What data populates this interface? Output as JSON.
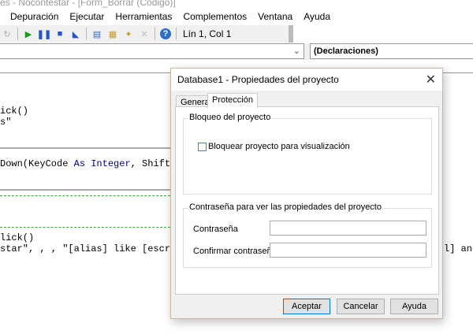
{
  "window": {
    "title": "es - Nocontestar - [Form_Borrar (Código)]"
  },
  "menu": [
    "Depuración",
    "Ejecutar",
    "Herramientas",
    "Complementos",
    "Ventana",
    "Ayuda"
  ],
  "toolbar": {
    "position": "Lín 1, Col 1"
  },
  "combos": {
    "object": "",
    "procedure": "(Declaraciones)"
  },
  "code": {
    "l1": "ick()",
    "l2": "s\"",
    "l3a": "Down(KeyCode ",
    "l3b": "As",
    "l3c": " ",
    "l3d": "Integer",
    "l3e": ", Shift A",
    "l4": "lick()",
    "l5": "star\", , , \"[alias] like [escrib",
    "l5r": "l] and"
  },
  "dialog": {
    "title": "Database1 - Propiedades del proyecto",
    "tabs": [
      "General",
      "Protección"
    ],
    "lock_group": "Bloqueo del proyecto",
    "lock_checkbox": "Bloquear proyecto para visualización",
    "lock_checked": false,
    "password_group": "Contraseña para ver las propiedades del proyecto",
    "password_label": "Contraseña",
    "confirm_label": "Confirmar contraseña",
    "password_value": "",
    "confirm_value": "",
    "buttons": {
      "ok": "Aceptar",
      "cancel": "Cancelar",
      "help": "Ayuda"
    }
  }
}
